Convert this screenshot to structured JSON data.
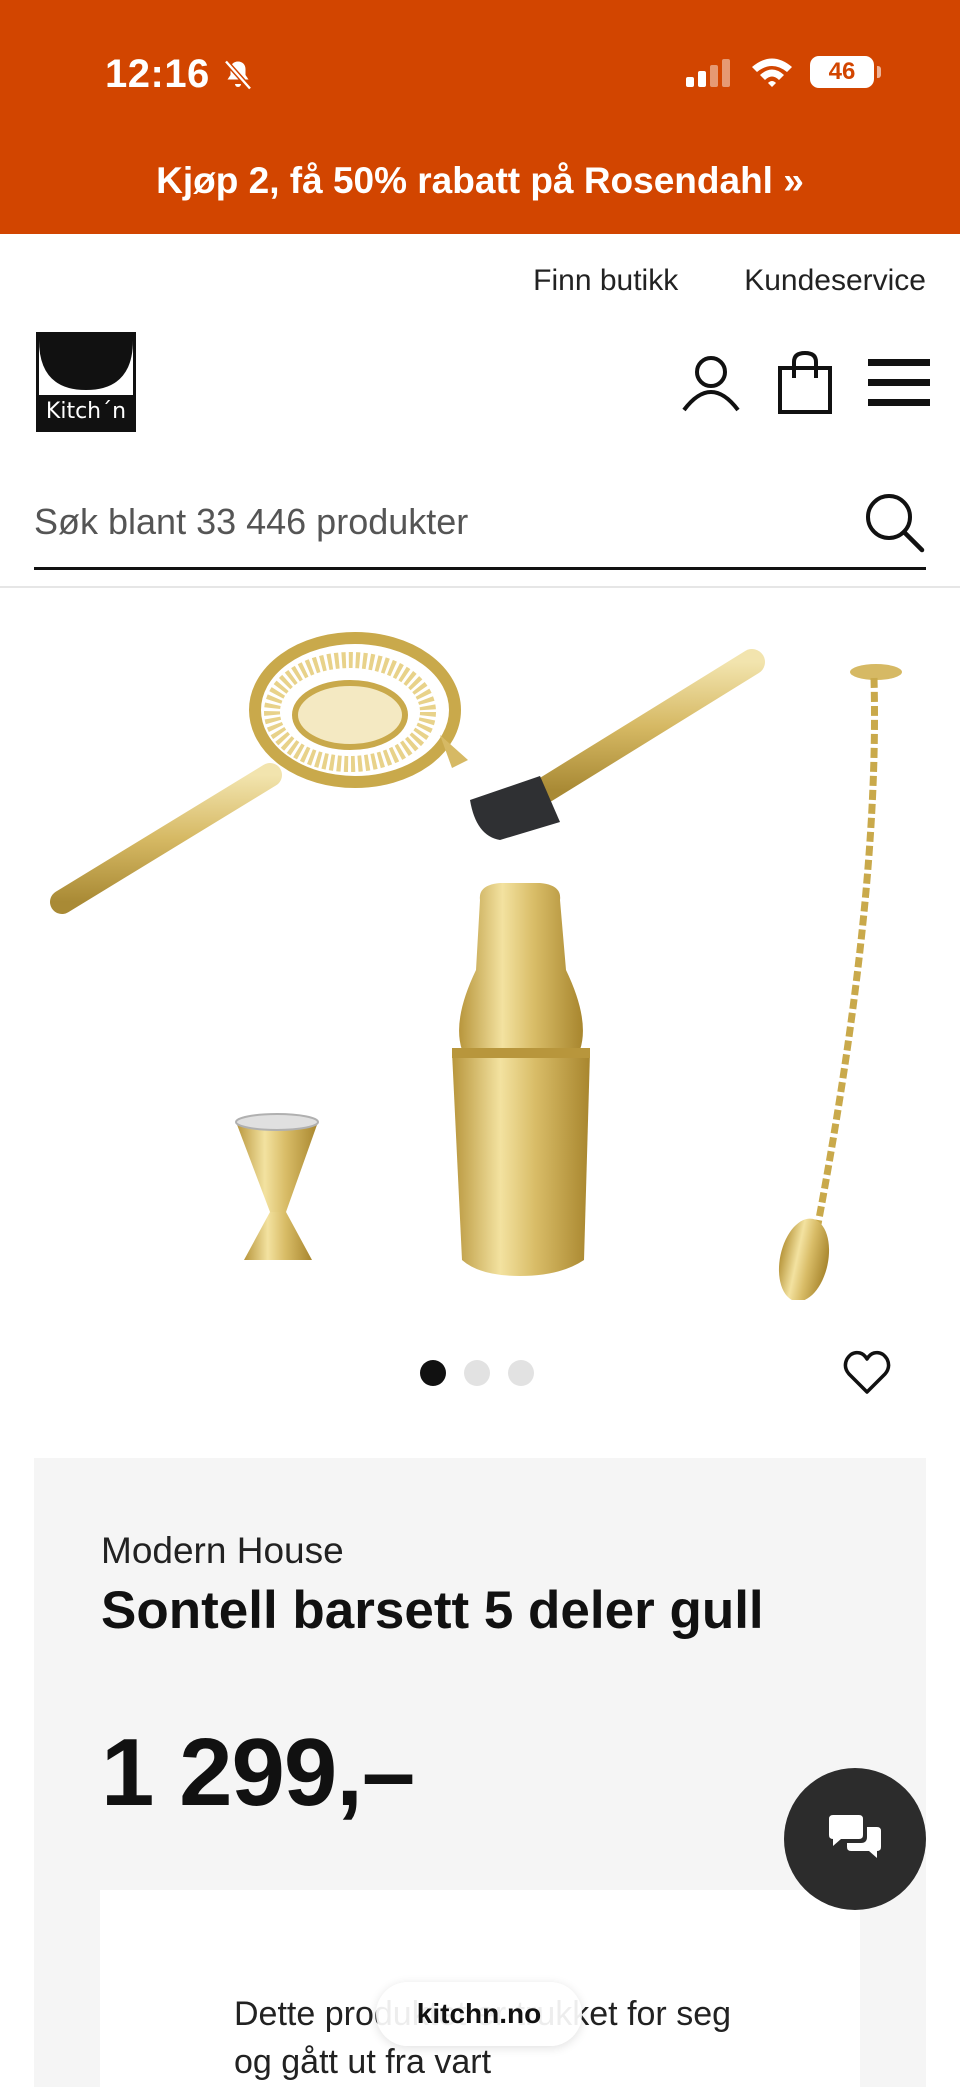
{
  "status_bar": {
    "time": "12:16",
    "battery": "46"
  },
  "promo": {
    "text": "Kjøp 2, få 50% rabatt på Rosendahl »"
  },
  "utility_links": {
    "store": "Finn butikk",
    "service": "Kundeservice"
  },
  "logo": {
    "text": "Kitch´n"
  },
  "search": {
    "placeholder": "Søk blant 33 446 produkter"
  },
  "gallery": {
    "slide_count": 3,
    "active_slide": 1
  },
  "product": {
    "brand": "Modern House",
    "title": "Sontell barsett 5 deler gull",
    "price": "1 299,–",
    "notice": "Dette produktet er trukket for seg og gått ut fra vart"
  },
  "browser": {
    "url": "kitchn.no"
  },
  "colors": {
    "brand_orange": "#d24500",
    "dark": "#111111",
    "card_bg": "#f5f5f5",
    "gold": "#d4b658"
  }
}
